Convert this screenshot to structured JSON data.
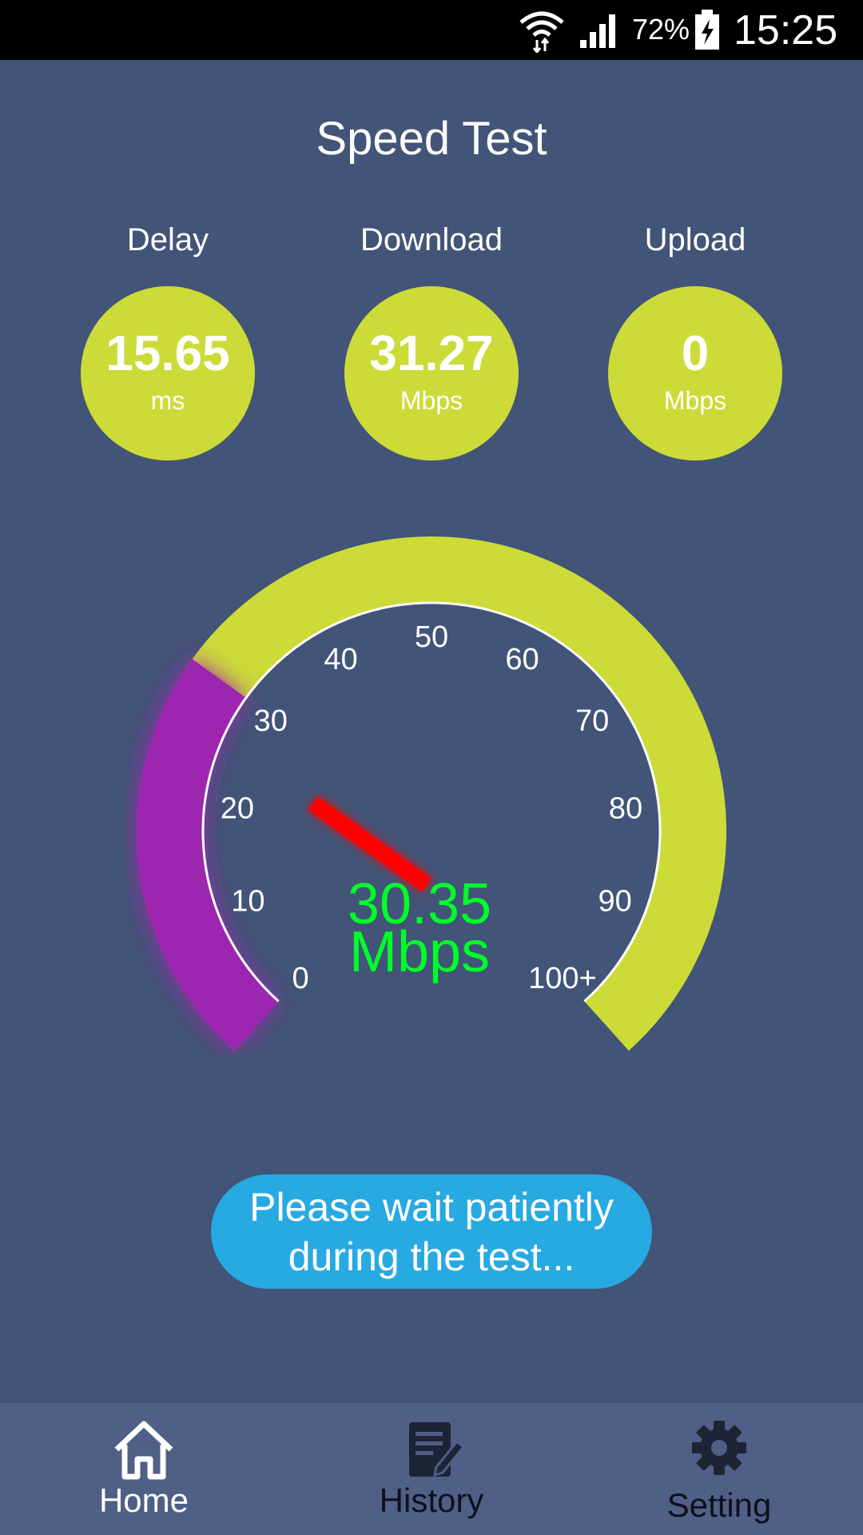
{
  "status_bar": {
    "battery_percent": "72%",
    "time": "15:25",
    "icons": [
      "wifi-icon",
      "signal-icon",
      "battery-charging-icon"
    ]
  },
  "title": "Speed Test",
  "metrics": {
    "delay": {
      "label": "Delay",
      "value": "15.65",
      "unit": "ms"
    },
    "download": {
      "label": "Download",
      "value": "31.27",
      "unit": "Mbps"
    },
    "upload": {
      "label": "Upload",
      "value": "0",
      "unit": "Mbps"
    }
  },
  "gauge": {
    "ticks": [
      "0",
      "10",
      "20",
      "30",
      "40",
      "50",
      "60",
      "70",
      "80",
      "90",
      "100+"
    ],
    "current_value": 30.35,
    "reading": "30.35",
    "unit": "Mbps",
    "max": 100,
    "colors": {
      "track": "#ccdb37",
      "progress": "#9c27b0",
      "glow": "#4caf50",
      "needle": "#ff0000",
      "reading": "#00ff2a"
    }
  },
  "message": "Please wait patiently\nduring the test...",
  "nav": {
    "home": {
      "label": "Home",
      "icon": "home-icon"
    },
    "history": {
      "label": "History",
      "icon": "history-icon"
    },
    "setting": {
      "label": "Setting",
      "icon": "gear-icon"
    }
  }
}
